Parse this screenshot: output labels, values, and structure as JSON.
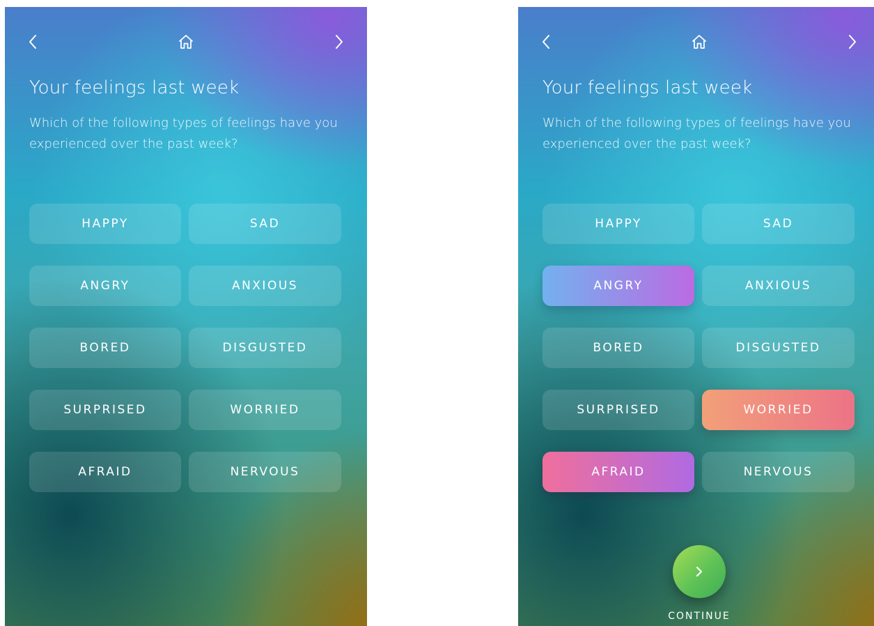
{
  "colors": {
    "angry_selected": [
      "#73b1ef",
      "#bb6be2"
    ],
    "worried_selected": [
      "#f2a079",
      "#ec7387"
    ],
    "afraid_selected": [
      "#ef6f9c",
      "#b06ae2"
    ],
    "continue_button": [
      "#a6dd55",
      "#3fae55"
    ]
  },
  "icons": {
    "back": "chevron-left-icon",
    "home": "home-icon",
    "forward": "chevron-right-icon",
    "continue": "chevron-right-icon"
  },
  "screen_left": {
    "title": "Your feelings last week",
    "subtitle": "Which of the following types of feelings have you experienced over the past week?",
    "feelings": [
      {
        "label": "HAPPY",
        "selected": false
      },
      {
        "label": "SAD",
        "selected": false
      },
      {
        "label": "ANGRY",
        "selected": false
      },
      {
        "label": "ANXIOUS",
        "selected": false
      },
      {
        "label": "BORED",
        "selected": false
      },
      {
        "label": "DISGUSTED",
        "selected": false
      },
      {
        "label": "SURPRISED",
        "selected": false
      },
      {
        "label": "WORRIED",
        "selected": false
      },
      {
        "label": "AFRAID",
        "selected": false
      },
      {
        "label": "NERVOUS",
        "selected": false
      }
    ]
  },
  "screen_right": {
    "title": "Your feelings last week",
    "subtitle": "Which of the following types of feelings have you experienced over the past week?",
    "feelings": [
      {
        "label": "HAPPY",
        "selected": false
      },
      {
        "label": "SAD",
        "selected": false
      },
      {
        "label": "ANGRY",
        "selected": true
      },
      {
        "label": "ANXIOUS",
        "selected": false
      },
      {
        "label": "BORED",
        "selected": false
      },
      {
        "label": "DISGUSTED",
        "selected": false
      },
      {
        "label": "SURPRISED",
        "selected": false
      },
      {
        "label": "WORRIED",
        "selected": true
      },
      {
        "label": "AFRAID",
        "selected": true
      },
      {
        "label": "NERVOUS",
        "selected": false
      }
    ],
    "continue_label": "CONTINUE"
  }
}
